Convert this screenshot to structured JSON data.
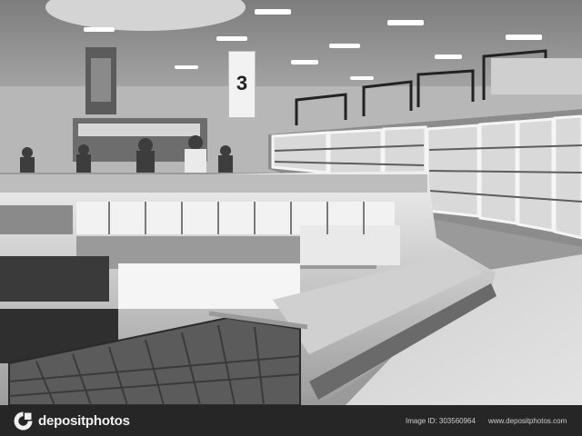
{
  "photo": {
    "aisle_sign_text": "3",
    "palette": {
      "ceiling": "#8f8f8f",
      "floor": "#d8d8d8",
      "glass": "#e6e6e6",
      "dark": "#2a2a2a"
    }
  },
  "footer": {
    "brand": "depositphotos",
    "brand_icon": "depositphotos-logo-icon",
    "image_id": "Image ID: 303560964",
    "site_url": "www.depositphotos.com",
    "background": "#262626"
  }
}
